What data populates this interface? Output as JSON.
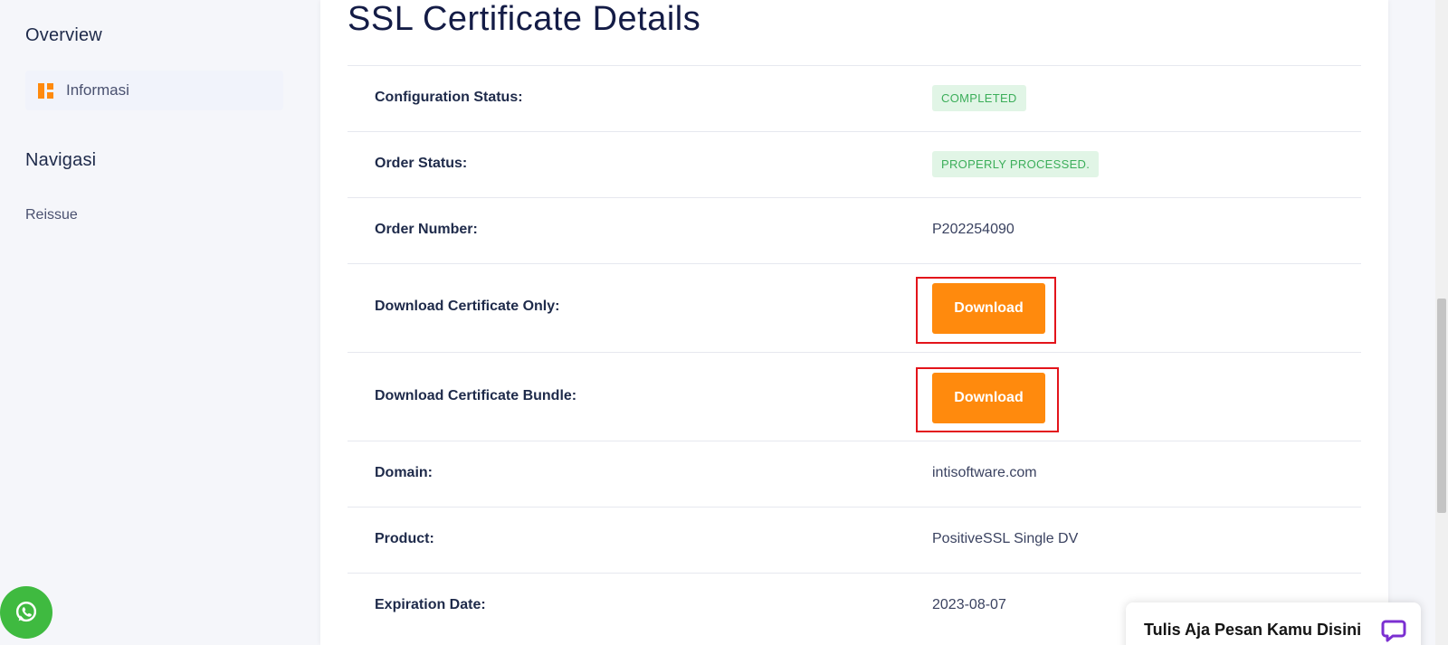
{
  "sidebar": {
    "overview_heading": "Overview",
    "active_item": {
      "label": "Informasi",
      "icon": "dashboard-icon"
    },
    "navigasi_heading": "Navigasi",
    "nav_link": "Reissue"
  },
  "main": {
    "title": "SSL Certificate Details",
    "rows": [
      {
        "label": "Configuration Status:",
        "badge": "COMPLETED"
      },
      {
        "label": "Order Status:",
        "badge": "PROPERLY PROCESSED."
      },
      {
        "label": "Order Number:",
        "value": "P202254090"
      },
      {
        "label": "Download Certificate Only:",
        "button": "Download"
      },
      {
        "label": "Download Certificate Bundle:",
        "button": "Download"
      },
      {
        "label": "Domain:",
        "value": "intisoftware.com"
      },
      {
        "label": "Product:",
        "value": "PositiveSSL Single DV"
      },
      {
        "label": "Expiration Date:",
        "value": "2023-08-07"
      }
    ]
  },
  "chat_widget": {
    "text": "Tulis Aja Pesan Kamu Disini",
    "icon": "chat-bubble-icon"
  },
  "whatsapp": {
    "icon": "whatsapp-icon"
  },
  "colors": {
    "accent": "#ff8a0d",
    "badge_bg": "#e1f5e6",
    "badge_text": "#3cae5a",
    "highlight_frame": "#e3141b",
    "whatsapp": "#3fba40",
    "chat_icon": "#7b2fd1"
  }
}
